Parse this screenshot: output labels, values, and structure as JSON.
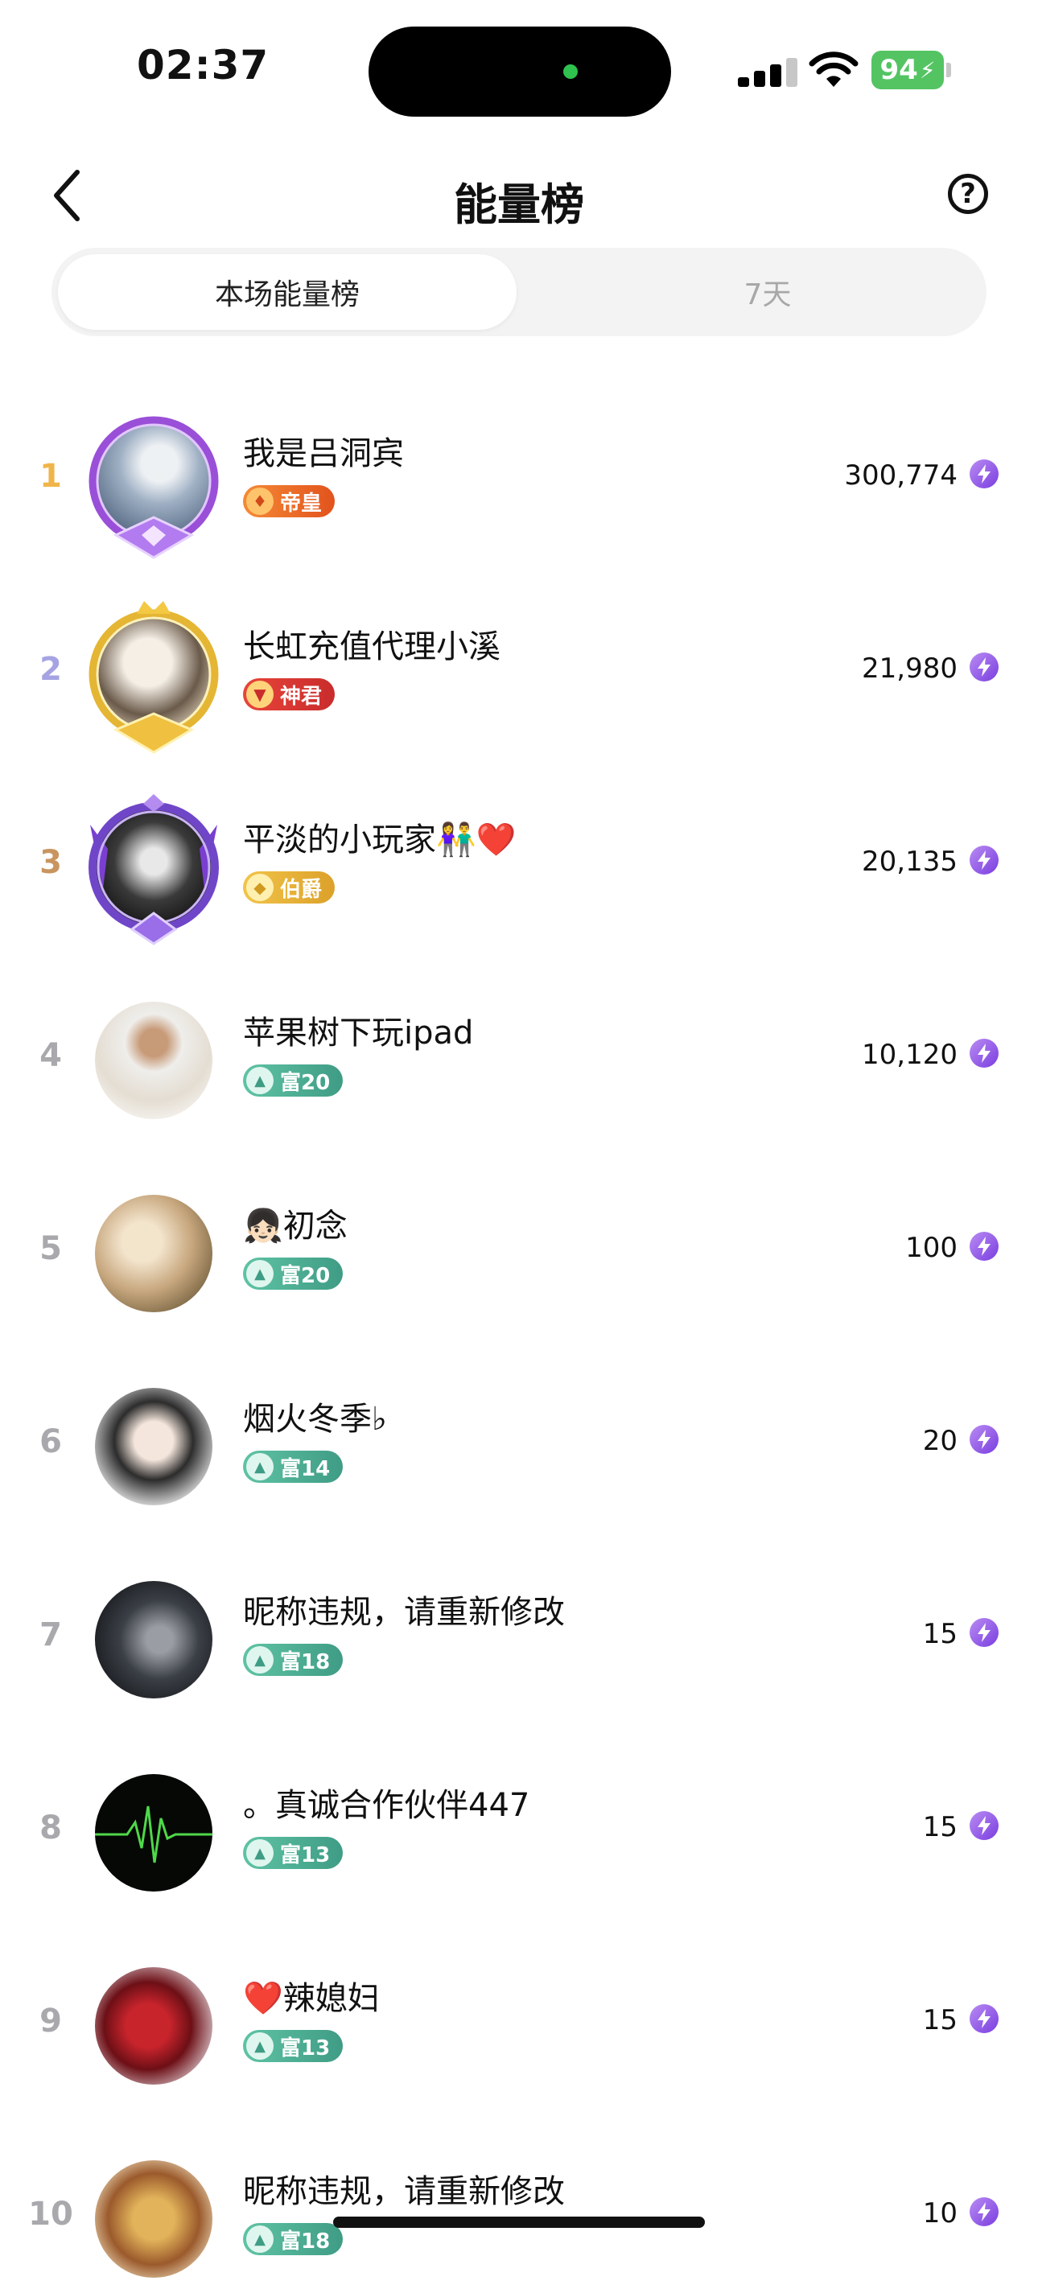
{
  "status": {
    "time": "02:37",
    "battery": "94"
  },
  "header": {
    "title": "能量榜"
  },
  "tabs": [
    {
      "label": "本场能量榜"
    },
    {
      "label": "7天"
    }
  ],
  "ranking": [
    {
      "rank": "1",
      "name": "我是吕洞宾",
      "badge": "帝皇",
      "score": "300,774"
    },
    {
      "rank": "2",
      "name": "长虹充值代理小溪",
      "badge": "神君",
      "score": "21,980"
    },
    {
      "rank": "3",
      "name": "平淡的小玩家👫❤️",
      "badge": "伯爵",
      "score": "20,135"
    },
    {
      "rank": "4",
      "name": "苹果树下玩ipad",
      "badge": "富20",
      "score": "10,120"
    },
    {
      "rank": "5",
      "name": "👧🏻初念",
      "badge": "富20",
      "score": "100"
    },
    {
      "rank": "6",
      "name": "烟火冬季♭",
      "badge": "富14",
      "score": "20"
    },
    {
      "rank": "7",
      "name": "昵称违规，请重新修改",
      "badge": "富18",
      "score": "15"
    },
    {
      "rank": "8",
      "name": "。真诚合作伙伴447",
      "badge": "富13",
      "score": "15"
    },
    {
      "rank": "9",
      "name": "❤️辣媳妇",
      "badge": "富13",
      "score": "15"
    },
    {
      "rank": "10",
      "name": "昵称违规，请重新修改",
      "badge": "富18",
      "score": "10"
    }
  ],
  "colors": {
    "rank1": "#f0b54a",
    "rank2": "#a6a3e3",
    "rank3": "#c9955f",
    "rank_other": "#a9a9ad",
    "badge_emperor": "#f07a2a",
    "badge_god": "#e0402e",
    "badge_count": "#e7b434",
    "badge_wealth": "#4fb59a",
    "energy_icon": "#8a4ae6"
  },
  "icons": [
    "back-chevron-icon",
    "help-question-icon",
    "signal-icon",
    "wifi-icon",
    "battery-icon",
    "energy-bolt-icon"
  ]
}
